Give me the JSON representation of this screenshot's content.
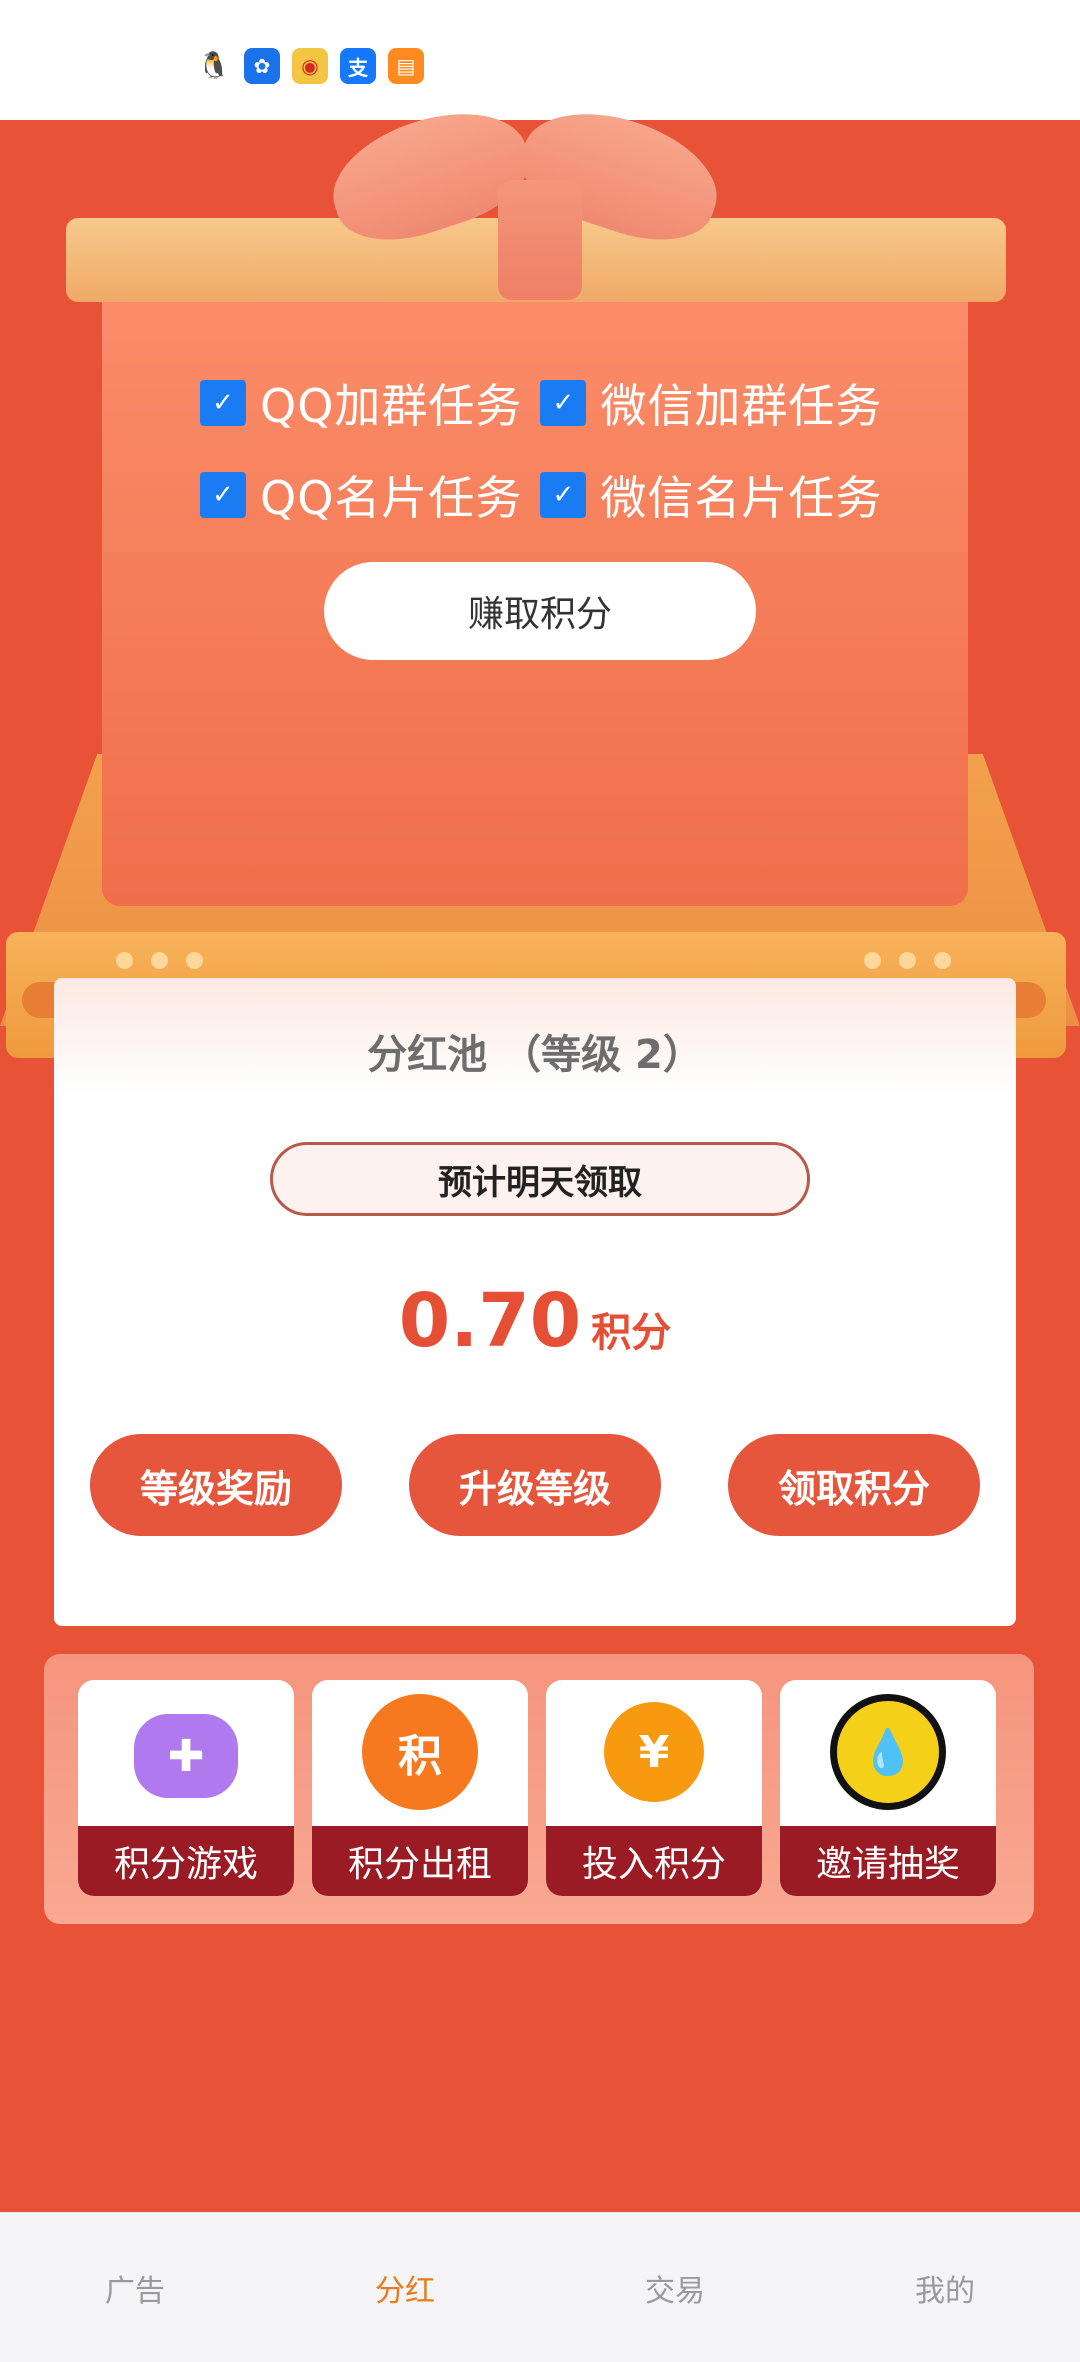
{
  "status_bar": {
    "notification_icons": [
      {
        "name": "qq-icon",
        "glyph": "🐧"
      },
      {
        "name": "pinwheel-app-icon",
        "glyph": "✿"
      },
      {
        "name": "weibo-icon",
        "glyph": "◉"
      },
      {
        "name": "alipay-icon",
        "glyph": "支"
      },
      {
        "name": "book-app-icon",
        "glyph": "▤"
      }
    ]
  },
  "hero": {
    "tasks": [
      {
        "label": "QQ加群任务",
        "checked": true
      },
      {
        "label": "微信加群任务",
        "checked": true
      },
      {
        "label": "QQ名片任务",
        "checked": true
      },
      {
        "label": "微信名片任务",
        "checked": true
      }
    ],
    "checkmark": "✓",
    "earn_button": "赚取积分"
  },
  "pool": {
    "title": "分红池 （等级 2）",
    "pill": "预计明天领取",
    "value": "0.70",
    "unit": "积分",
    "actions": [
      "等级奖励",
      "升级等级",
      "领取积分"
    ]
  },
  "features": [
    {
      "label": "积分游戏",
      "icon": "gamepad-icon",
      "glyph": "✚"
    },
    {
      "label": "积分出租",
      "icon": "points-hand-icon",
      "glyph": "积"
    },
    {
      "label": "投入积分",
      "icon": "yen-shield-hand-icon",
      "glyph": "¥"
    },
    {
      "label": "邀请抽奖",
      "icon": "lottery-drop-icon",
      "glyph": "💧"
    }
  ],
  "nav": {
    "items": [
      {
        "label": "广告",
        "active": false
      },
      {
        "label": "分红",
        "active": true
      },
      {
        "label": "交易",
        "active": false
      },
      {
        "label": "我的",
        "active": false
      }
    ],
    "active_color": "#e87a1a"
  }
}
